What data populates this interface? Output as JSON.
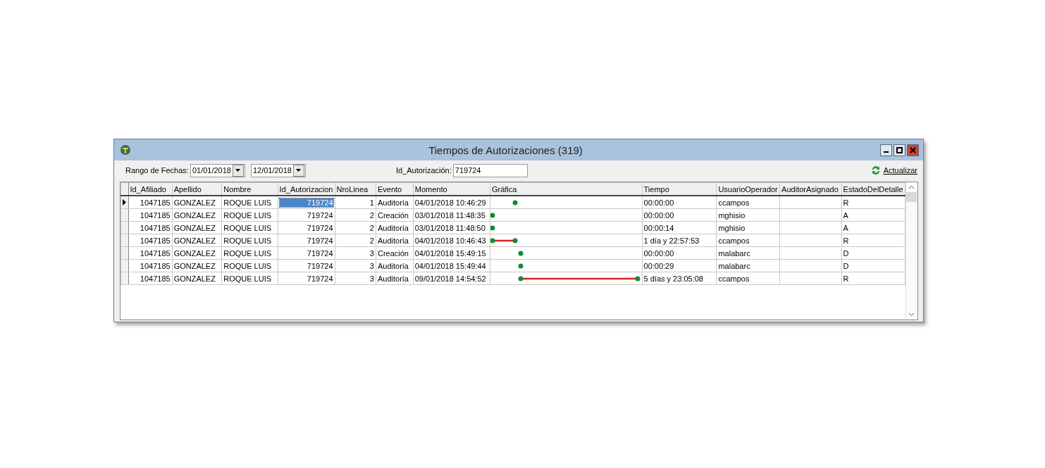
{
  "window": {
    "title": "Tiempos de Autorizaciones (319)"
  },
  "toolbar": {
    "date_range_label": "Rango de Fechas:",
    "date_from": "01/01/2018",
    "date_to": "12/01/2018",
    "id_label": "Id_Autorización:",
    "id_value": "719724",
    "refresh_button": "Actualizar"
  },
  "table": {
    "columns": [
      "Id_Afiliado",
      "Apellido",
      "Nombre",
      "Id_Autorizacion",
      "NroLinea",
      "Evento",
      "Momento",
      "Gráfica",
      "Tiempo",
      "UsuarioOperador",
      "AuditorAsignado",
      "EstadoDelDetalle"
    ],
    "rows": [
      {
        "selected": true,
        "cells": [
          "1047185",
          "GONZALEZ",
          "ROQUE LUIS",
          "719724",
          "1",
          "Auditoría",
          "04/01/2018 10:46:29",
          "",
          "00:00:00",
          "ccampos",
          "",
          "R"
        ]
      },
      {
        "selected": false,
        "cells": [
          "1047185",
          "GONZALEZ",
          "ROQUE LUIS",
          "719724",
          "2",
          "Creación",
          "03/01/2018 11:48:35",
          "",
          "00:00:00",
          "mghisio",
          "",
          "A"
        ]
      },
      {
        "selected": false,
        "cells": [
          "1047185",
          "GONZALEZ",
          "ROQUE LUIS",
          "719724",
          "2",
          "Auditoría",
          "03/01/2018 11:48:50",
          "",
          "00:00:14",
          "mghisio",
          "",
          "A"
        ]
      },
      {
        "selected": false,
        "cells": [
          "1047185",
          "GONZALEZ",
          "ROQUE LUIS",
          "719724",
          "2",
          "Auditoría",
          "04/01/2018 10:46:43",
          "",
          "1 día y 22:57:53",
          "ccampos",
          "",
          "R"
        ]
      },
      {
        "selected": false,
        "cells": [
          "1047185",
          "GONZALEZ",
          "ROQUE LUIS",
          "719724",
          "3",
          "Creación",
          "04/01/2018 15:49:15",
          "",
          "00:00:00",
          "malabarc",
          "",
          "D"
        ]
      },
      {
        "selected": false,
        "cells": [
          "1047185",
          "GONZALEZ",
          "ROQUE LUIS",
          "719724",
          "3",
          "Auditoría",
          "04/01/2018 15:49:44",
          "",
          "00:00:29",
          "malabarc",
          "",
          "D"
        ]
      },
      {
        "selected": false,
        "cells": [
          "1047185",
          "GONZALEZ",
          "ROQUE LUIS",
          "719724",
          "3",
          "Auditoría",
          "09/01/2018 14:54:52",
          "",
          "5 días y 23:05:08",
          "ccampos",
          "",
          "R"
        ]
      }
    ]
  }
}
